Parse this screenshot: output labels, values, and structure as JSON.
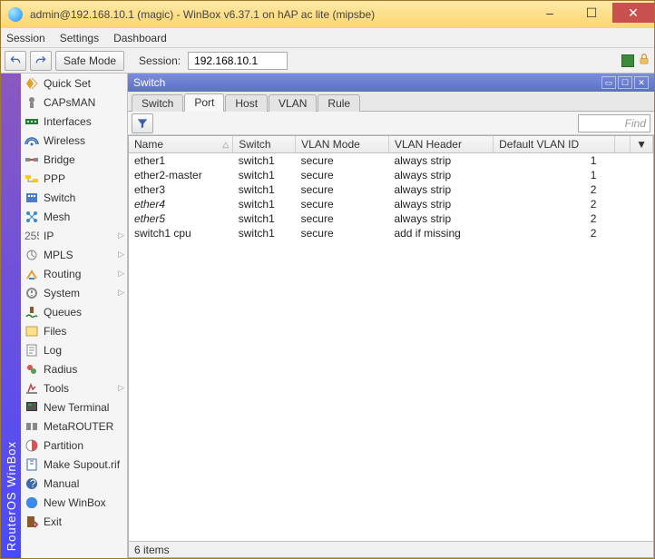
{
  "window": {
    "title": "admin@192.168.10.1 (magic) - WinBox v6.37.1 on hAP ac lite (mipsbe)"
  },
  "menubar": {
    "items": [
      "Session",
      "Settings",
      "Dashboard"
    ]
  },
  "toolbar": {
    "safe_mode": "Safe Mode",
    "session_label": "Session:",
    "session_value": "192.168.10.1"
  },
  "vbar": {
    "label": "RouterOS WinBox"
  },
  "sidebar": {
    "items": [
      {
        "label": "Quick Set",
        "sub": false
      },
      {
        "label": "CAPsMAN",
        "sub": false
      },
      {
        "label": "Interfaces",
        "sub": false
      },
      {
        "label": "Wireless",
        "sub": false
      },
      {
        "label": "Bridge",
        "sub": false
      },
      {
        "label": "PPP",
        "sub": false
      },
      {
        "label": "Switch",
        "sub": false
      },
      {
        "label": "Mesh",
        "sub": false
      },
      {
        "label": "IP",
        "sub": true
      },
      {
        "label": "MPLS",
        "sub": true
      },
      {
        "label": "Routing",
        "sub": true
      },
      {
        "label": "System",
        "sub": true
      },
      {
        "label": "Queues",
        "sub": false
      },
      {
        "label": "Files",
        "sub": false
      },
      {
        "label": "Log",
        "sub": false
      },
      {
        "label": "Radius",
        "sub": false
      },
      {
        "label": "Tools",
        "sub": true
      },
      {
        "label": "New Terminal",
        "sub": false
      },
      {
        "label": "MetaROUTER",
        "sub": false
      },
      {
        "label": "Partition",
        "sub": false
      },
      {
        "label": "Make Supout.rif",
        "sub": false
      },
      {
        "label": "Manual",
        "sub": false
      },
      {
        "label": "New WinBox",
        "sub": false
      },
      {
        "label": "Exit",
        "sub": false
      }
    ]
  },
  "panel": {
    "title": "Switch",
    "tabs": [
      "Switch",
      "Port",
      "Host",
      "VLAN",
      "Rule"
    ],
    "active_tab": "Port",
    "find_placeholder": "Find",
    "columns": [
      "Name",
      "Switch",
      "VLAN Mode",
      "VLAN Header",
      "Default VLAN ID"
    ],
    "rows": [
      {
        "name": "ether1",
        "switch": "switch1",
        "mode": "secure",
        "header": "always strip",
        "vid": "1",
        "italic": false
      },
      {
        "name": "ether2-master",
        "switch": "switch1",
        "mode": "secure",
        "header": "always strip",
        "vid": "1",
        "italic": false
      },
      {
        "name": "ether3",
        "switch": "switch1",
        "mode": "secure",
        "header": "always strip",
        "vid": "2",
        "italic": false
      },
      {
        "name": "ether4",
        "switch": "switch1",
        "mode": "secure",
        "header": "always strip",
        "vid": "2",
        "italic": true
      },
      {
        "name": "ether5",
        "switch": "switch1",
        "mode": "secure",
        "header": "always strip",
        "vid": "2",
        "italic": true
      },
      {
        "name": "switch1 cpu",
        "switch": "switch1",
        "mode": "secure",
        "header": "add if missing",
        "vid": "2",
        "italic": false
      }
    ],
    "status": "6 items"
  }
}
